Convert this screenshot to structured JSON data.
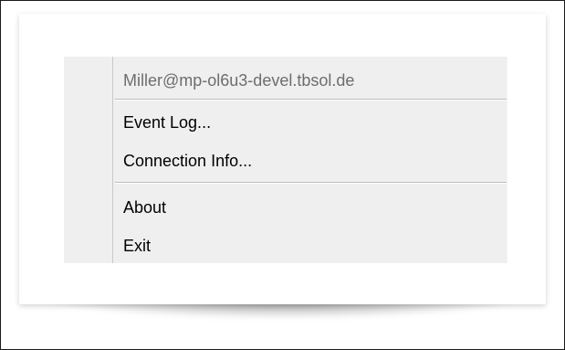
{
  "menu": {
    "header": "Miller@mp-ol6u3-devel.tbsol.de",
    "items": [
      {
        "label": "Event Log..."
      },
      {
        "label": "Connection Info..."
      },
      {
        "label": "About"
      },
      {
        "label": "Exit"
      }
    ]
  }
}
